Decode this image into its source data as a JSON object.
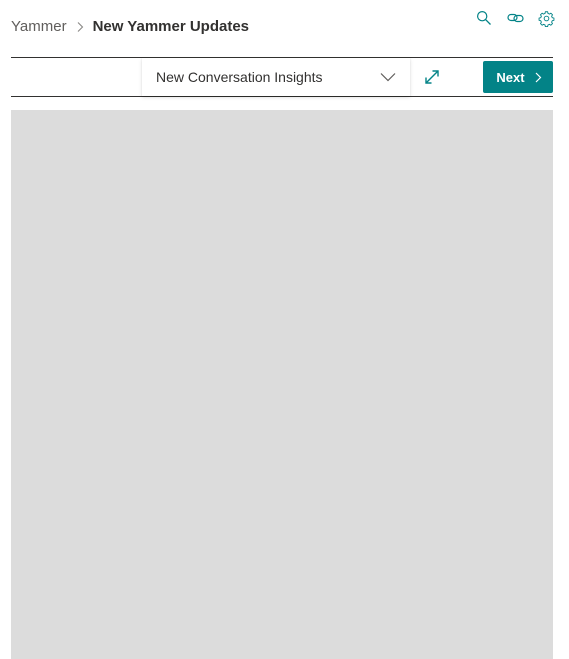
{
  "breadcrumb": {
    "parent": "Yammer",
    "current": "New Yammer Updates"
  },
  "top_actions": [
    {
      "icon": "search-icon"
    },
    {
      "icon": "link-icon"
    },
    {
      "icon": "gear-icon"
    }
  ],
  "toolbar": {
    "report_select_value": "New Conversation Insights",
    "expand_icon": "expand-icon",
    "next_label": "Next"
  },
  "colors": {
    "accent": "#038387",
    "frame_background": "#dcdcdc",
    "rule": "#323130"
  }
}
